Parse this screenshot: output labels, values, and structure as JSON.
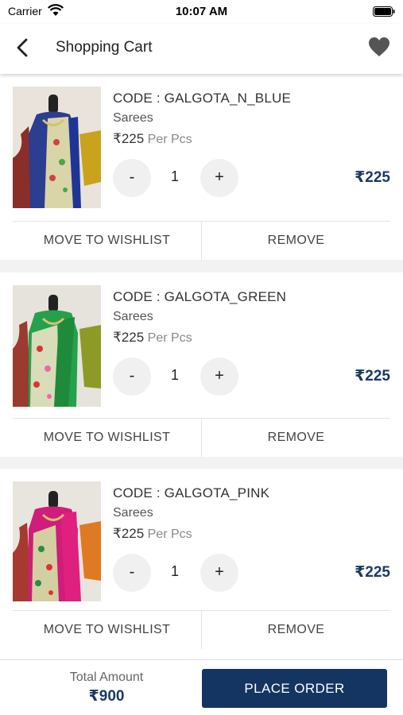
{
  "status_bar": {
    "carrier": "Carrier",
    "time": "10:07 AM"
  },
  "header": {
    "title": "Shopping Cart",
    "back_icon": "chevron-left-icon",
    "wishlist_icon": "heart-icon"
  },
  "colors": {
    "primary": "#143561",
    "price": "#1a3a64",
    "background": "#f2f2f2"
  },
  "cart": {
    "items": [
      {
        "code": "CODE : GALGOTA_N_BLUE",
        "category": "Sarees",
        "price": "₹225",
        "unit": "Per Pcs",
        "minus": "-",
        "qty": "1",
        "plus": "+",
        "line_total": "₹225",
        "wishlist": "MOVE TO WISHLIST",
        "remove": "REMOVE"
      },
      {
        "code": "CODE : GALGOTA_GREEN",
        "category": "Sarees",
        "price": "₹225",
        "unit": "Per Pcs",
        "minus": "-",
        "qty": "1",
        "plus": "+",
        "line_total": "₹225",
        "wishlist": "MOVE TO WISHLIST",
        "remove": "REMOVE"
      },
      {
        "code": "CODE : GALGOTA_PINK",
        "category": "Sarees",
        "price": "₹225",
        "unit": "Per Pcs",
        "minus": "-",
        "qty": "1",
        "plus": "+",
        "line_total": "₹225",
        "wishlist": "MOVE TO WISHLIST",
        "remove": "REMOVE"
      }
    ]
  },
  "footer": {
    "total_label": "Total Amount",
    "total_value": "₹900",
    "place_order": "PLACE ORDER"
  }
}
